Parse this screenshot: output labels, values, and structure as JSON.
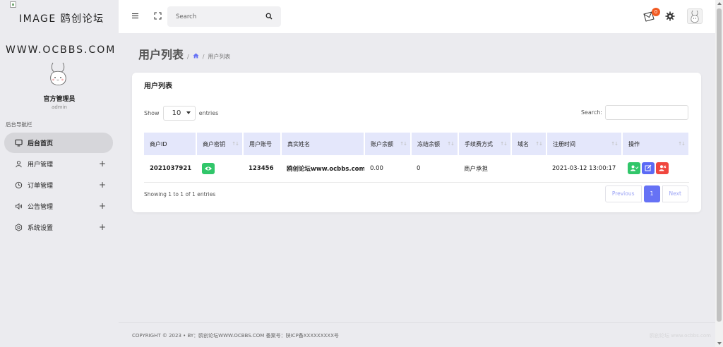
{
  "brand": {
    "logo_text": "IMAGE 鸥创论坛",
    "site_name": "WWW.OCBBS.COM",
    "admin_title": "官方管理员",
    "admin_user": "admin"
  },
  "sidebar": {
    "heading": "后台导航栏",
    "items": [
      {
        "label": "后台首页",
        "icon": "monitor-icon",
        "expandable": false,
        "active": true
      },
      {
        "label": "用户管理",
        "icon": "user-icon",
        "expandable": true,
        "active": false
      },
      {
        "label": "订单管理",
        "icon": "clock-icon",
        "expandable": true,
        "active": false
      },
      {
        "label": "公告管理",
        "icon": "speaker-icon",
        "expandable": true,
        "active": false
      },
      {
        "label": "系统设置",
        "icon": "settings-icon",
        "expandable": true,
        "active": false
      }
    ],
    "expand_symbol": "+"
  },
  "topbar": {
    "search_placeholder": "Search",
    "notification_count": "0"
  },
  "breadcrumb": {
    "title": "用户列表",
    "separator": "/",
    "current": "用户列表"
  },
  "card": {
    "title": "用户列表",
    "show_label": "Show",
    "page_length": "10",
    "entries_label": "entries",
    "search_label": "Search:",
    "columns": [
      "商户ID",
      "商户密钥",
      "用户账号",
      "真实姓名",
      "账户余额",
      "冻结余额",
      "手续费方式",
      "域名",
      "注册时间",
      "操作"
    ],
    "rows": [
      {
        "id": "2021037921",
        "key": "",
        "account": "123456",
        "real_name": "鸥创论坛www.ocbbs.com",
        "balance": "0.00",
        "frozen": "0",
        "fee_mode": "商户承担",
        "domain": "",
        "registered": "2021-03-12 13:00:17"
      }
    ],
    "info": "Showing 1 to 1 of 1 entries",
    "pager": {
      "previous": "Previous",
      "current": "1",
      "next": "Next"
    }
  },
  "footer": {
    "copyright": "COPYRIGHT © 2023 • BY：鸥创论坛WWW.OCBBS.COM   备案号：陕ICP备XXXXXXXXX号",
    "watermark": "鸥创论坛 www.ocbbs.com"
  },
  "colors": {
    "accent": "#6672f5",
    "success": "#31c66a",
    "danger": "#f0463e",
    "badge": "#f15a22",
    "link": "#4a5ae8",
    "table_header": "#e4e7fb"
  }
}
